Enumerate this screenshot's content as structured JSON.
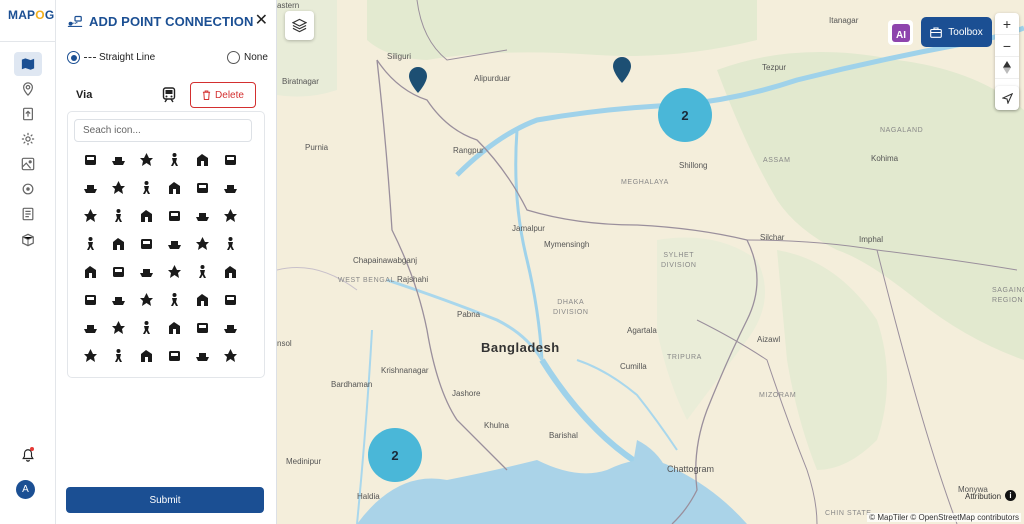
{
  "app": {
    "logo_text": "MAPOG",
    "brand_color": "#1b4f93"
  },
  "rail": {
    "icons": [
      "map-icon",
      "location-pin-icon",
      "upload-icon",
      "gear-icon",
      "layers-map-icon",
      "settings-cog-icon",
      "report-icon",
      "cube-map-icon"
    ],
    "notification_icon": "bell-icon",
    "avatar_letter": "A"
  },
  "panel": {
    "title": "ADD POINT CONNECTION",
    "close_symbol": "✕",
    "options": [
      {
        "label": "Straight Line",
        "selected": true
      },
      {
        "label": "None",
        "selected": false
      }
    ],
    "via_label": "Via",
    "delete_label": "Delete",
    "search_placeholder": "Seach icon...",
    "submit_label": "Submit"
  },
  "map": {
    "toolbox_label": "Toolbox",
    "ai_label": "AI",
    "zoom_in": "+",
    "zoom_out": "−",
    "clusters": [
      {
        "count": "2"
      },
      {
        "count": "2"
      }
    ],
    "labels": {
      "siliguri": "Siliguri",
      "itanagar": "Itanagar",
      "biratnagar": "Biratnagar",
      "alipurduar": "Alipurduar",
      "tezpur": "Tezpur",
      "purnia": "Purnia",
      "rangpur": "Rangpur",
      "nagaland": "NAGALAND",
      "shillong": "Shillong",
      "assam": "ASSAM",
      "kohima": "Kohima",
      "meghalaya": "MEGHALAYA",
      "jamalpur": "Jamalpur",
      "mymensingh": "Mymensingh",
      "silchar": "Silchar",
      "imphal": "Imphal",
      "chapainawabganj": "Chapainawabganj",
      "sylhet": "SYLHET\nDIVISION",
      "rajshahi": "Rajshahi",
      "west_bengal": "WEST BENGAL",
      "dhaka_div": "DHAKA\nDIVISION",
      "sagaing": "SAGAING\nREGION",
      "pabna": "Pabna",
      "agartala": "Agartala",
      "bangladesh": "Bangladesh",
      "nsol": "nsol",
      "tripura": "TRIPURA",
      "aizawl": "Aizawl",
      "krishnanagar": "Krishnanagar",
      "cumilla": "Cumilla",
      "bardhaman": "Bardhaman",
      "jashore": "Jashore",
      "mizoram": "MIZORAM",
      "khulna": "Khulna",
      "barishal": "Barishal",
      "medinipur": "Medinipur",
      "chattogram": "Chattogram",
      "haldia": "Haldia",
      "monywa": "Monywa",
      "chin_state": "CHIN STATE",
      "eastern": "astern"
    },
    "attribution_label": "Attribution",
    "attribution_text": "© MapTiler © OpenStreetMap contributors"
  }
}
